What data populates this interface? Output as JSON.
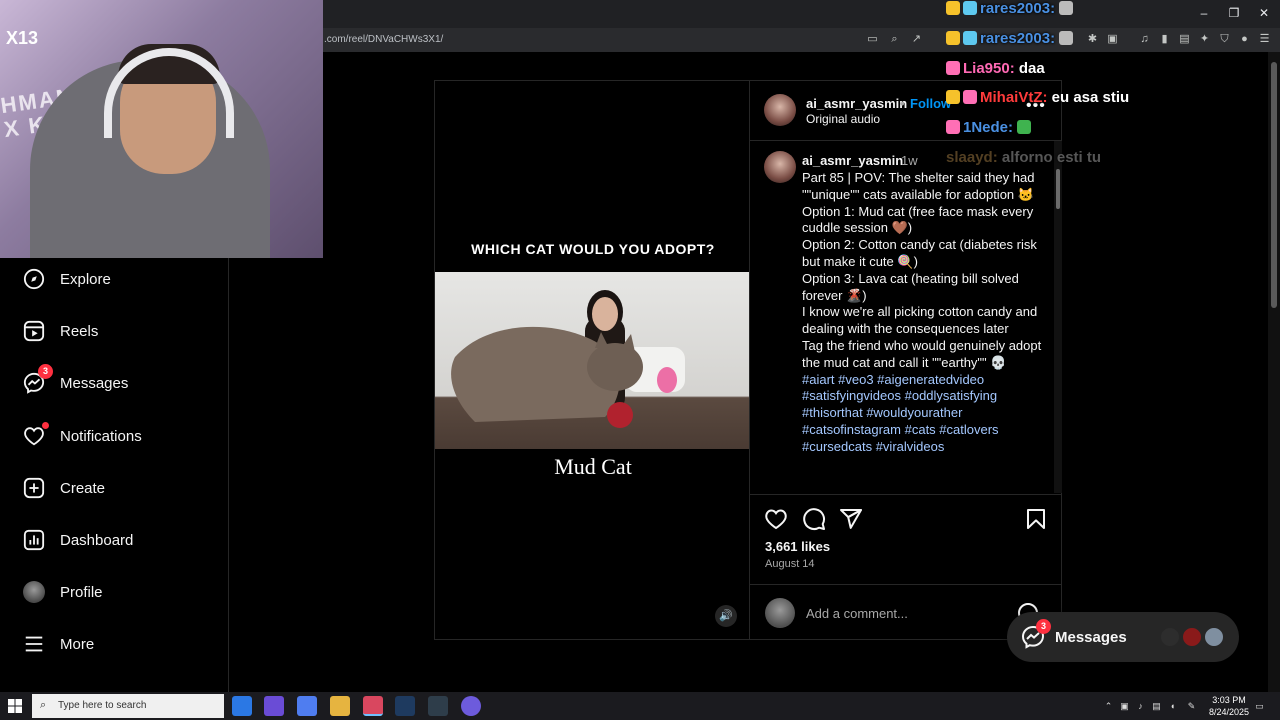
{
  "browser": {
    "url": ".com/reel/DNVaCHWs3X1/"
  },
  "webcam": {
    "tag": "X13",
    "wall_text": "HMAN X KICK"
  },
  "sidebar": {
    "items": [
      {
        "label": "Explore",
        "icon": "compass-icon"
      },
      {
        "label": "Reels",
        "icon": "reels-icon"
      },
      {
        "label": "Messages",
        "icon": "messenger-icon",
        "badge": "3"
      },
      {
        "label": "Notifications",
        "icon": "heart-icon"
      },
      {
        "label": "Create",
        "icon": "plus-square-icon"
      },
      {
        "label": "Dashboard",
        "icon": "dashboard-icon"
      },
      {
        "label": "Profile",
        "icon": "profile-avatar-icon"
      },
      {
        "label": "More",
        "icon": "hamburger-icon"
      }
    ]
  },
  "reel": {
    "heading": "WHICH CAT WOULD YOU ADOPT?",
    "caption": "Mud Cat"
  },
  "post": {
    "username": "ai_asmr_yasmin",
    "follow_label": "Follow",
    "audio": "Original audio",
    "caption_time": "1w",
    "caption_text": "Part 85 | POV: The shelter said they had \"\"unique\"\" cats available for adoption 🐱\nOption 1: Mud cat (free face mask every cuddle session 🤎)\nOption 2: Cotton candy cat (diabetes risk but make it cute 🍭)\nOption 3: Lava cat (heating bill solved forever 🌋)\nI know we're all picking cotton candy and dealing with the consequences later\nTag the friend who would genuinely adopt the mud cat and call it \"\"earthy\"\" 💀",
    "hashtags": "#aiart #veo3 #aigeneratedvideo #satisfyingvideos #oddlysatisfying #thisorthat #wouldyourather #catsofinstagram #cats #catlovers #cursedcats #viralvideos",
    "likes": "3,661 likes",
    "date": "August 14",
    "comment_placeholder": "Add a comment..."
  },
  "chat": [
    {
      "user": "rares2003:",
      "message": "",
      "color": "#4a90e2"
    },
    {
      "user": "rares2003:",
      "message": "",
      "color": "#4a90e2"
    },
    {
      "user": "Lia950:",
      "message": "daa",
      "color": "#ff69b4"
    },
    {
      "user": "MihaiVtZ:",
      "message": "eu asa stiu",
      "color": "#ff3b3b"
    },
    {
      "user": "1Nede:",
      "message": "",
      "color": "#4a90e2"
    },
    {
      "user": "slaayd:",
      "message": "alforno esti tu",
      "color": "#8a6a3a"
    }
  ],
  "messages_pill": {
    "label": "Messages",
    "badge": "3"
  },
  "taskbar": {
    "search_placeholder": "Type here to search",
    "time": "3:03 PM",
    "date": "8/24/2025"
  }
}
